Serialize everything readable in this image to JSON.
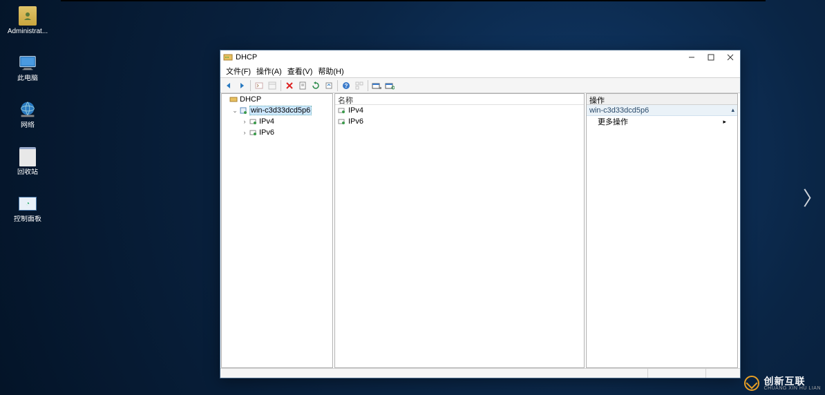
{
  "desktop": {
    "icons": [
      {
        "label": "Administrat..."
      },
      {
        "label": "此电脑"
      },
      {
        "label": "网络"
      },
      {
        "label": "回收站"
      },
      {
        "label": "控制面板"
      }
    ]
  },
  "window": {
    "title": "DHCP",
    "menu": {
      "file": "文件(F)",
      "action": "操作(A)",
      "view": "查看(V)",
      "help": "帮助(H)"
    },
    "tree": {
      "root": "DHCP",
      "server": "win-c3d33dcd5p6",
      "ipv4": "IPv4",
      "ipv6": "IPv6"
    },
    "list": {
      "col_name": "名称",
      "items": [
        {
          "label": "IPv4"
        },
        {
          "label": "IPv6"
        }
      ]
    },
    "actions": {
      "header": "操作",
      "group": "win-c3d33dcd5p6",
      "more": "更多操作"
    }
  },
  "watermark": {
    "title": "创新互联",
    "sub": "CHUANG XIN HU LIAN"
  }
}
